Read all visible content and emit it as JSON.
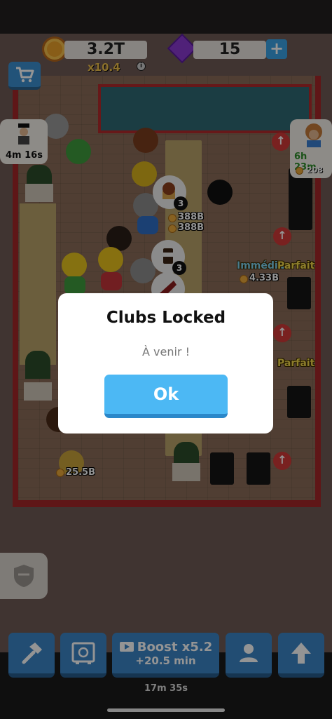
{
  "currency": {
    "coins": "3.2T",
    "multiplier": "x10.4",
    "gems": "15",
    "info_glyph": "i",
    "plus_glyph": "+"
  },
  "characters": {
    "left_timer": "4m 16s",
    "right_timer": "6h 23m",
    "right_count": "208"
  },
  "scene": {
    "money_labels": [
      "388B",
      "388B",
      "4.33B",
      "25.5B"
    ],
    "bubble_count": "3",
    "station_labels": [
      "Immédia",
      "Parfait",
      "Parfait"
    ]
  },
  "dialog": {
    "title": "Clubs Locked",
    "subtitle": "À venir !",
    "ok_label": "Ok"
  },
  "bottom": {
    "boost_label": "Boost x5.2",
    "boost_time": "+20.5 min",
    "timer": "17m 35s"
  },
  "colors": {
    "accent_blue": "#3c86c7",
    "ok_blue": "#4cb8f4",
    "wall_red": "#a42628"
  }
}
